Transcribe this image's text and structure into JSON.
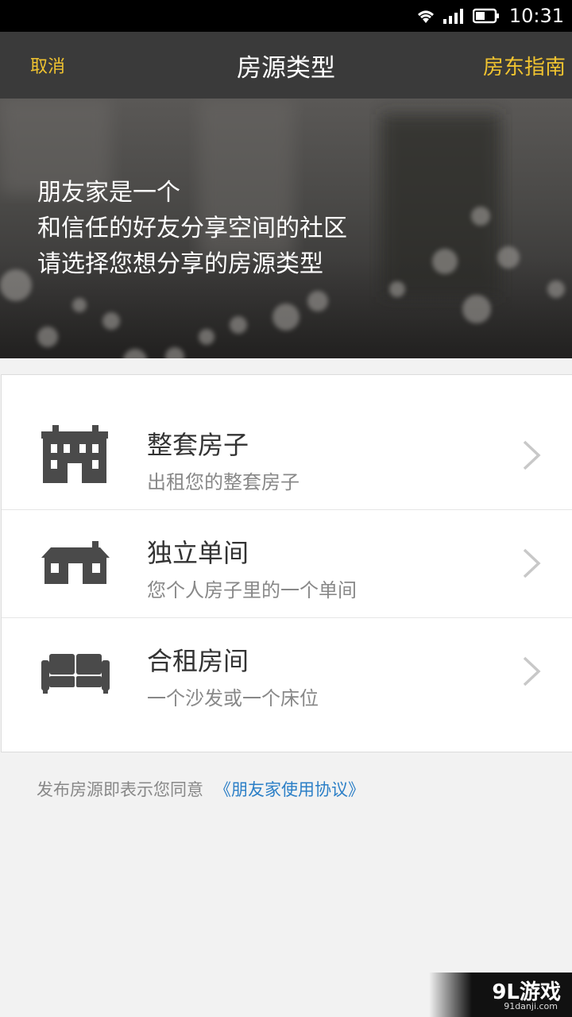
{
  "status_bar": {
    "time": "10:31",
    "icons": [
      "wifi-icon",
      "signal-icon",
      "battery-icon"
    ]
  },
  "nav": {
    "cancel_label": "取消",
    "title": "房源类型",
    "guide_label": "房东指南"
  },
  "hero": {
    "lines": [
      "朋友家是一个",
      "和信任的好友分享空间的社区",
      "请选择您想分享的房源类型"
    ]
  },
  "listing_types": [
    {
      "icon": "apartment-building-icon",
      "title": "整套房子",
      "subtitle": "出租您的整套房子"
    },
    {
      "icon": "house-icon",
      "title": "独立单间",
      "subtitle": "您个人房子里的一个单间"
    },
    {
      "icon": "sofa-icon",
      "title": "合租房间",
      "subtitle": "一个沙发或一个床位"
    }
  ],
  "agreement": {
    "text": "发布房源即表示您同意",
    "link_label": "《朋友家使用协议》"
  },
  "watermark": {
    "main": "9L游戏",
    "sub": "91danji.com"
  },
  "colors": {
    "accent": "#f0c330",
    "nav_bg": "#3a3a3a",
    "link": "#2b7fc7",
    "icon": "#4a4a4a"
  }
}
